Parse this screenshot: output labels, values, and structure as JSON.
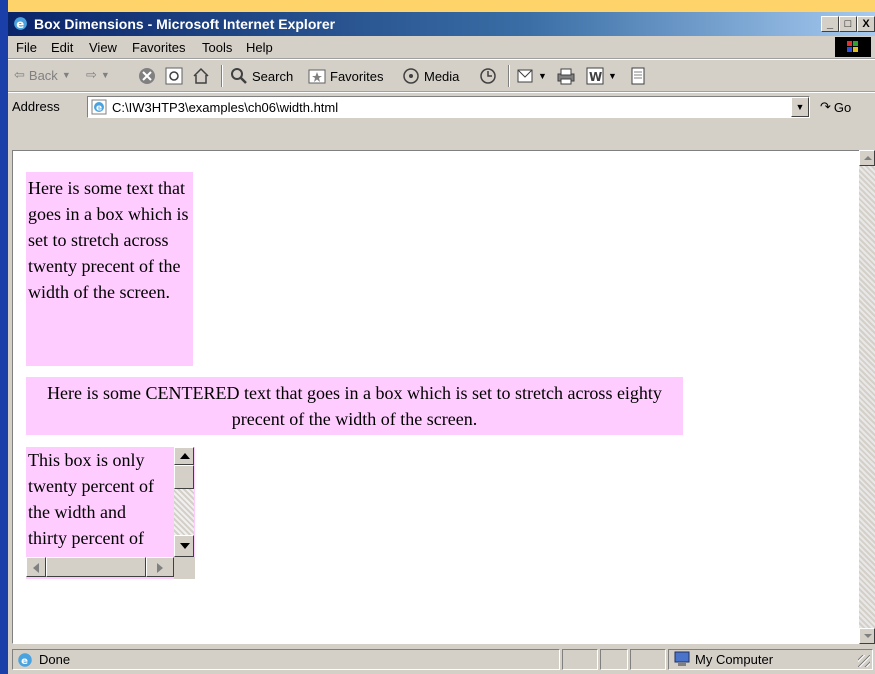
{
  "window": {
    "title": "Box Dimensions - Microsoft Internet Explorer",
    "minimize": "_",
    "maximize": "□",
    "close": "X"
  },
  "menu": [
    "File",
    "Edit",
    "View",
    "Favorites",
    "Tools",
    "Help"
  ],
  "toolbar": {
    "back": "Back",
    "search": "Search",
    "favorites": "Favorites",
    "media": "Media"
  },
  "address": {
    "label": "Address",
    "url": "C:\\IW3HTP3\\examples\\ch06\\width.html",
    "go": "Go"
  },
  "page": {
    "box1": "Here is some text that goes in a box which is set to stretch across twenty precent of the width of the screen.",
    "box2": "Here is some CENTERED text that goes in a box which is set to stretch across eighty precent of the width of the screen.",
    "box3": "This box is only twenty percent of the width and thirty percent of the height."
  },
  "status": {
    "text": "Done",
    "zone": "My Computer"
  },
  "colors": {
    "box_bg": "#ffccff",
    "title_gradient_start": "#0a246a",
    "chrome": "#d4d0c8"
  }
}
